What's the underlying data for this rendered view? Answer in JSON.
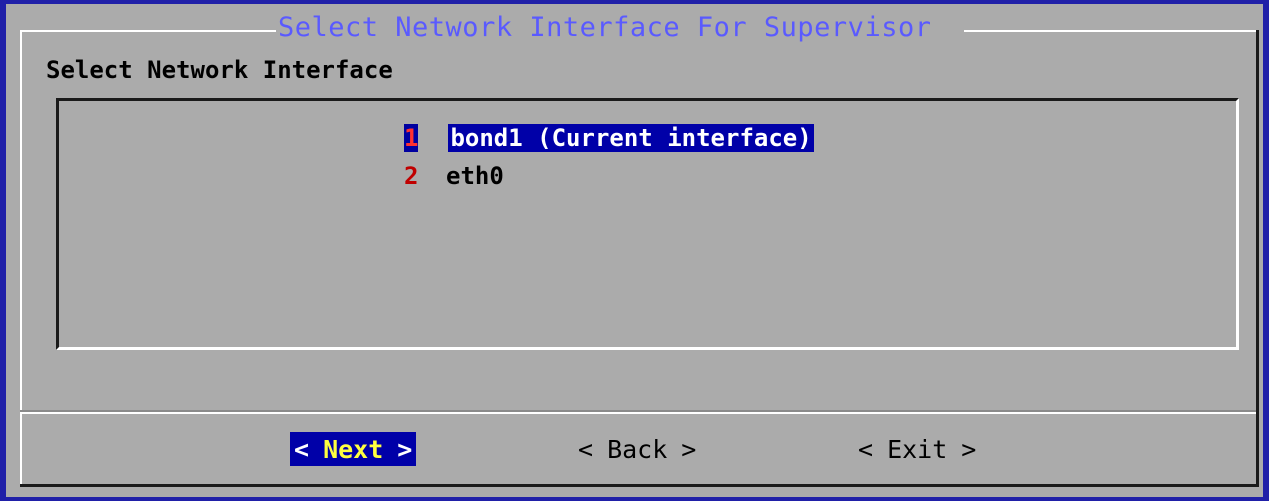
{
  "dialog": {
    "title": "Select Network Interface For Supervisor",
    "prompt": "Select Network Interface"
  },
  "menu": {
    "items": [
      {
        "num": "1",
        "label": "bond1 (Current interface)",
        "selected": true
      },
      {
        "num": "2",
        "label": "eth0",
        "selected": false
      }
    ]
  },
  "buttons": {
    "next": {
      "left": "<",
      "label": "Next",
      "right": ">"
    },
    "back": {
      "left": "<",
      "label": "Back",
      "right": ">"
    },
    "exit": {
      "left": "<",
      "label": "Exit",
      "right": ">"
    }
  },
  "colors": {
    "background": "#2020a8",
    "dialog": "#ababab",
    "title": "#5a5aff",
    "highlight": "#0000a8",
    "hotkey": "#c00000",
    "focused_button_text": "#ffff40"
  }
}
